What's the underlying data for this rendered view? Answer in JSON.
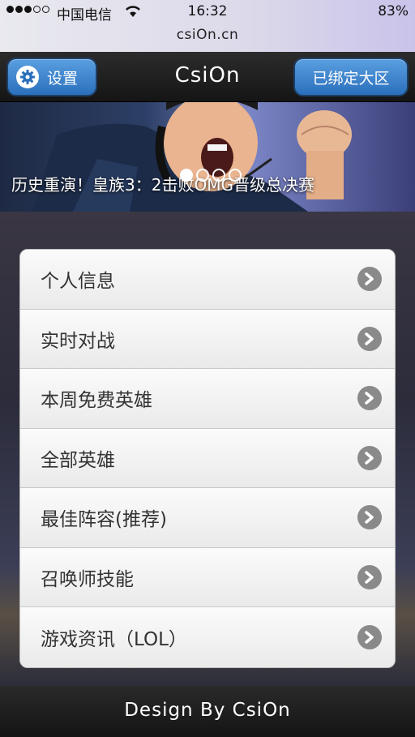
{
  "status_bar": {
    "carrier": "中国电信",
    "time": "16:32",
    "battery": "83%",
    "url": "csiOn.cn"
  },
  "navbar": {
    "title": "CsiOn",
    "settings_label": "设置",
    "bind_label": "已绑定大区"
  },
  "banner": {
    "caption": "历史重演！皇族3：2击败OMG晋级总决赛",
    "slides": 4,
    "active_slide": 1
  },
  "menu": {
    "items": [
      {
        "label": "个人信息"
      },
      {
        "label": "实时对战"
      },
      {
        "label": "本周免费英雄"
      },
      {
        "label": "全部英雄"
      },
      {
        "label": "最佳阵容(推荐)"
      },
      {
        "label": "召唤师技能"
      },
      {
        "label": "游戏资讯（LOL）"
      }
    ]
  },
  "footer": {
    "text": "Design By CsiOn"
  },
  "colors": {
    "nav_button": "#3f86d0",
    "nav_bg": "#1f1f1f",
    "arrow_icon": "#8a8a8a"
  }
}
